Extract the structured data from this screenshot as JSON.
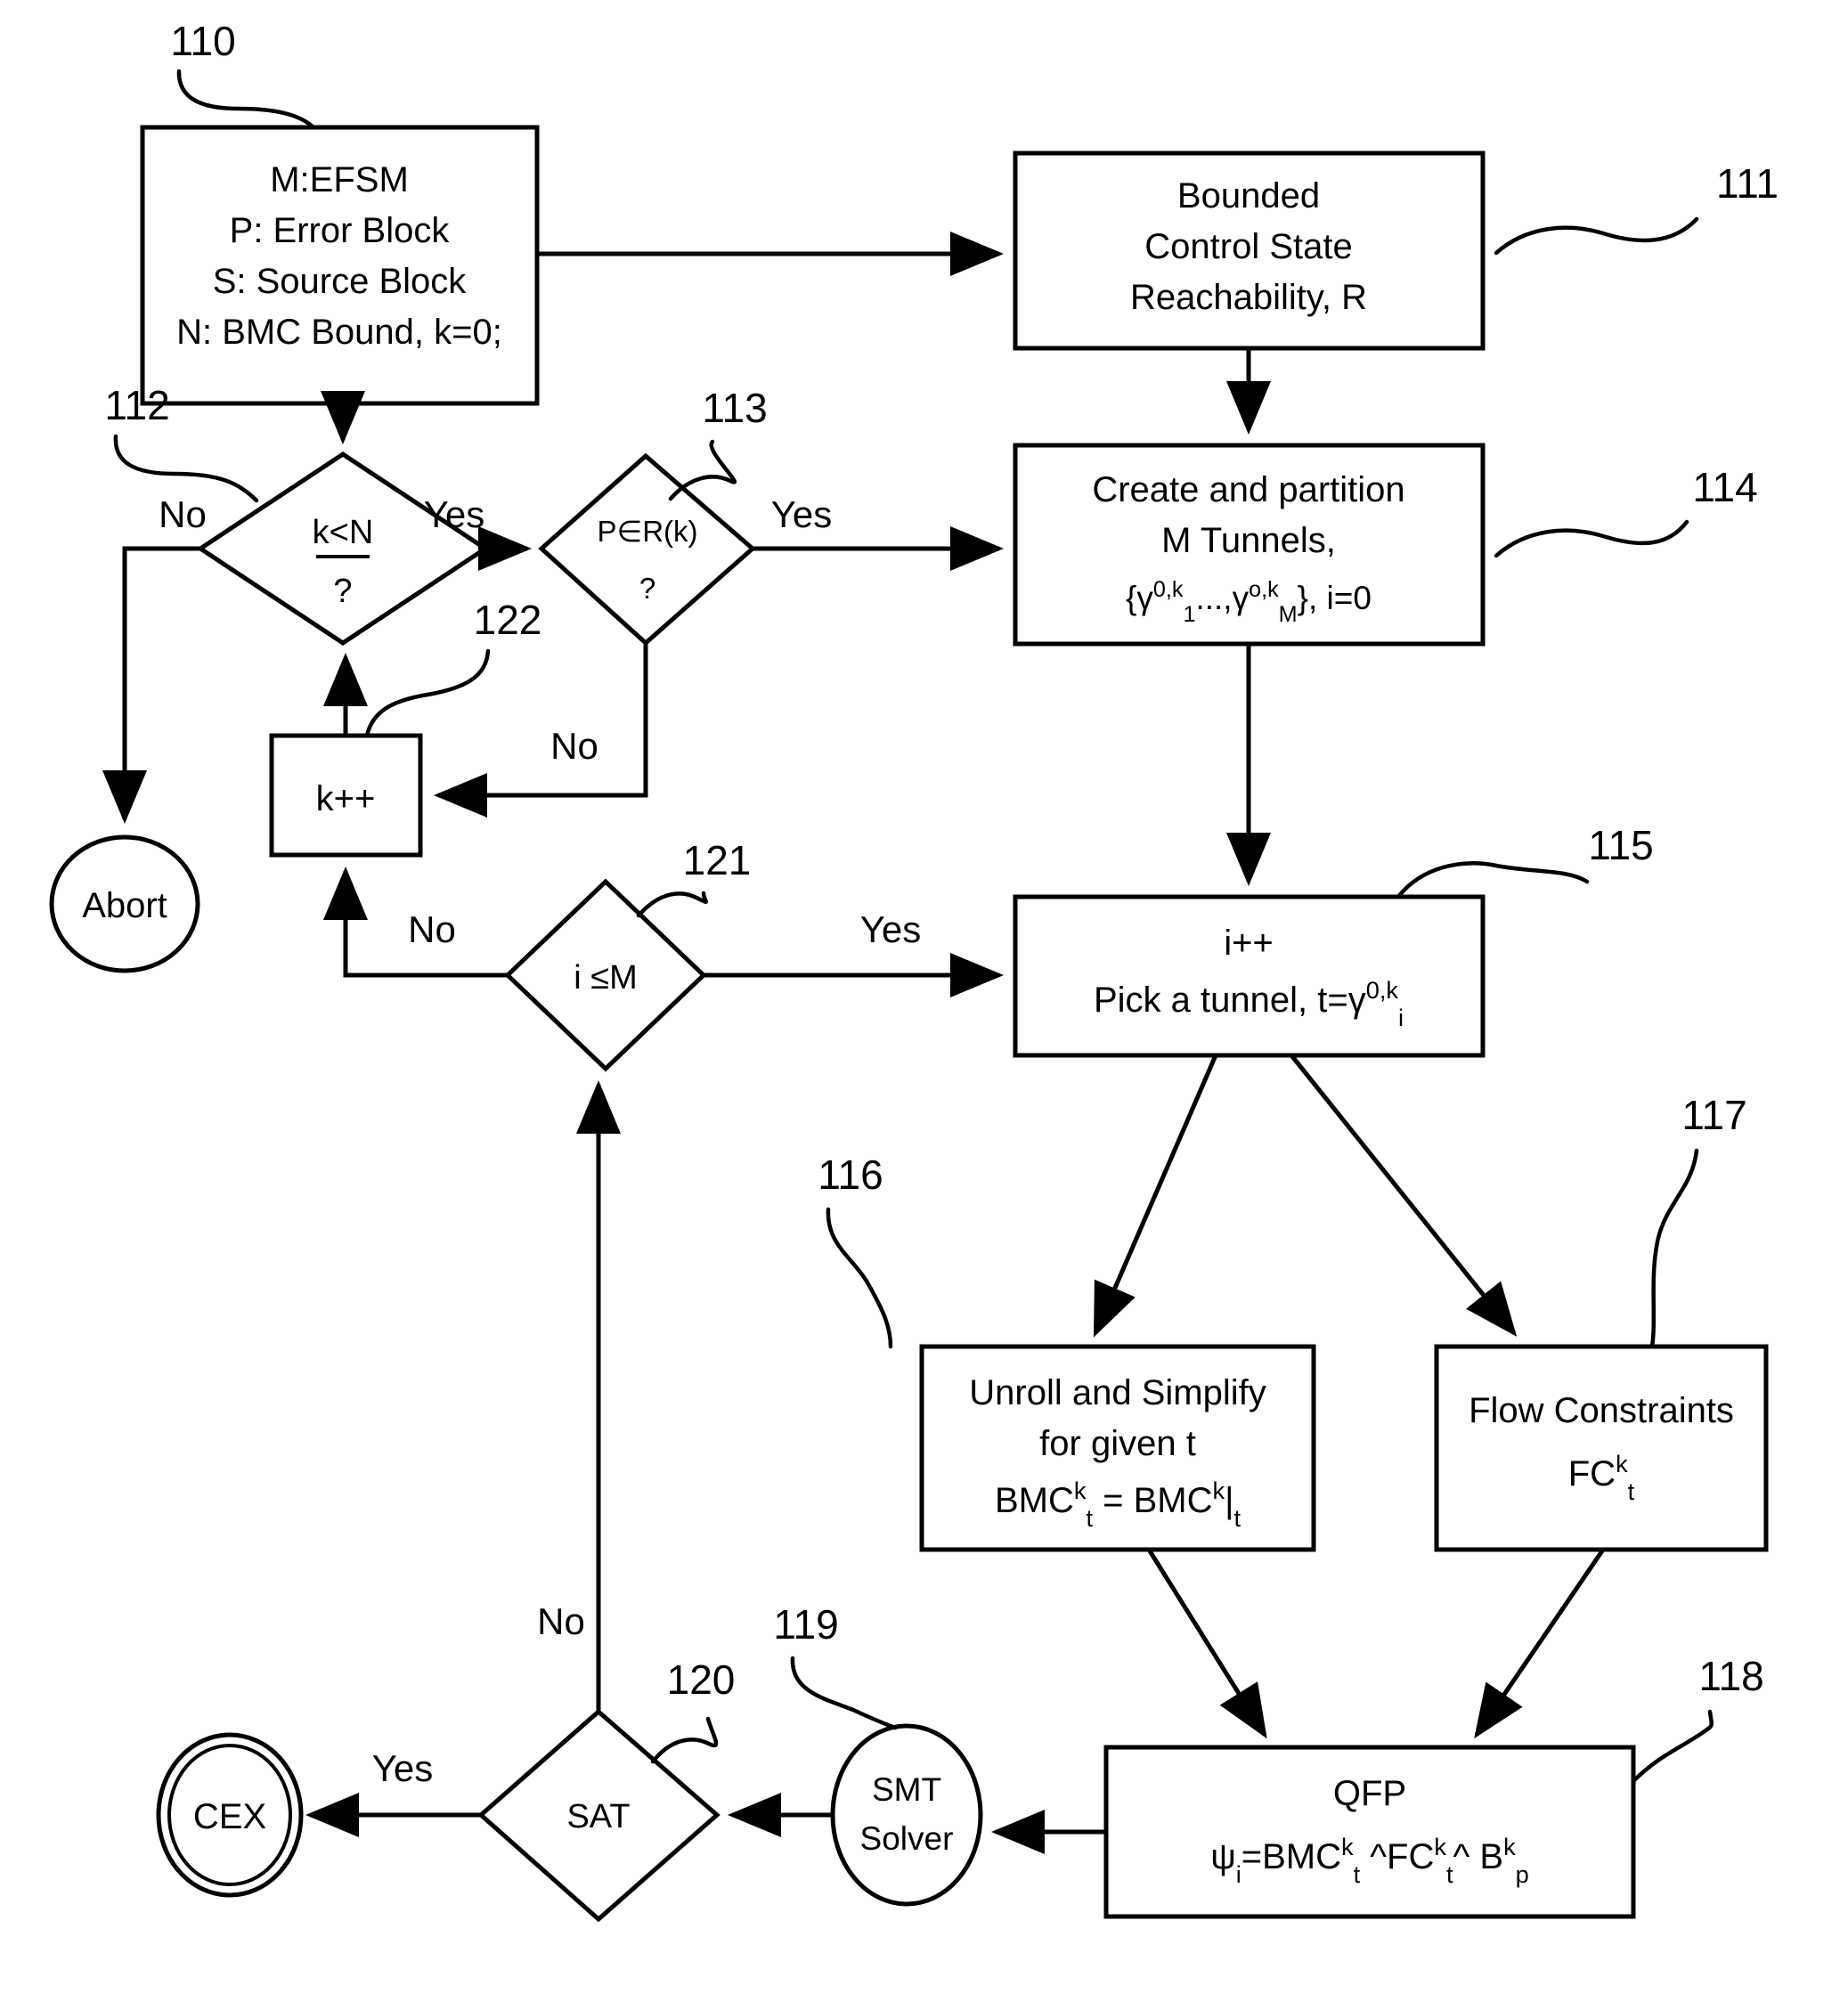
{
  "diagram": {
    "title": "Tunneling BMC verification flowchart",
    "stroke_color": "#000000",
    "background_color": "#ffffff"
  },
  "nodes": {
    "n110": {
      "ref": "110",
      "shape": "rectangle",
      "lines": [
        "M:EFSM",
        "P: Error Block",
        "S: Source Block",
        "N: BMC Bound, k=0;"
      ]
    },
    "n111": {
      "ref": "111",
      "shape": "rectangle",
      "lines": [
        "Bounded",
        "Control State",
        "Reachability, R"
      ]
    },
    "n112": {
      "ref": "112",
      "shape": "diamond",
      "lines": [
        "k<N",
        "?"
      ],
      "has_underline": true
    },
    "n113": {
      "ref": "113",
      "shape": "diamond",
      "lines": [
        "P∈R(k)",
        "?"
      ]
    },
    "n114": {
      "ref": "114",
      "shape": "rectangle",
      "lines": [
        "Create and partition",
        "M Tunnels,",
        "{γ0,k1...,γo,kM}, i=0"
      ],
      "formula_parts": {
        "open": "{γ",
        "sup1": "0,k",
        "sub1": "1",
        "mid": "...,γ",
        "sup2": "o,k",
        "sub2": "M",
        "close": "}, i=0"
      }
    },
    "n115": {
      "ref": "115",
      "shape": "rectangle",
      "lines": [
        "i++",
        "Pick a tunnel, t=γ0,ki"
      ],
      "formula_parts": {
        "lead": "Pick a tunnel, t=γ",
        "sup": "0,k",
        "sub": "i"
      }
    },
    "n116": {
      "ref": "116",
      "shape": "rectangle",
      "lines": [
        "Unroll and Simplify",
        "for given t",
        "BMCkt = BMCk|t"
      ],
      "formula_parts": {
        "a": "BMC",
        "a_sup": "k",
        "a_sub": "t",
        "eq": " = ",
        "b": "BMC",
        "b_sup": "k",
        "bar": "|",
        "b_sub": "t"
      }
    },
    "n117": {
      "ref": "117",
      "shape": "rectangle",
      "lines": [
        "Flow Constraints",
        "FCkt"
      ],
      "formula_parts": {
        "a": "FC",
        "a_sup": "k",
        "a_sub": "t"
      }
    },
    "n118": {
      "ref": "118",
      "shape": "rectangle",
      "lines": [
        "QFP",
        "ψi=BMCkt ^FCkt^ Bkp"
      ],
      "formula_parts": {
        "psi": "ψ",
        "psi_sub": "i",
        "eq": "=BMC",
        "s1": "k",
        "b1": "t",
        "wedge1": " ^FC",
        "s2": "k",
        "b2": "t",
        "wedge2": "^ B",
        "s3": "k",
        "b3": "p"
      }
    },
    "n119": {
      "ref": "119",
      "shape": "ellipse",
      "lines": [
        "SMT",
        "Solver"
      ]
    },
    "n120": {
      "ref": "120",
      "shape": "diamond",
      "lines": [
        "SAT"
      ]
    },
    "n121": {
      "ref": "121",
      "shape": "diamond",
      "lines": [
        "i ≤M"
      ]
    },
    "n122": {
      "ref": "122",
      "shape": "rectangle",
      "lines": [
        "k++"
      ]
    },
    "abort": {
      "shape": "circle",
      "lines": [
        "Abort"
      ]
    },
    "cex": {
      "shape": "double-circle",
      "lines": [
        "CEX"
      ]
    }
  },
  "edge_labels": {
    "no_112": "No",
    "yes_112": "Yes",
    "yes_113": "Yes",
    "no_113": "No",
    "yes_121": "Yes",
    "no_121": "No",
    "no_120": "No",
    "yes_120": "Yes"
  },
  "reference_numerals": [
    "110",
    "111",
    "112",
    "113",
    "114",
    "115",
    "116",
    "117",
    "118",
    "119",
    "120",
    "121",
    "122"
  ]
}
